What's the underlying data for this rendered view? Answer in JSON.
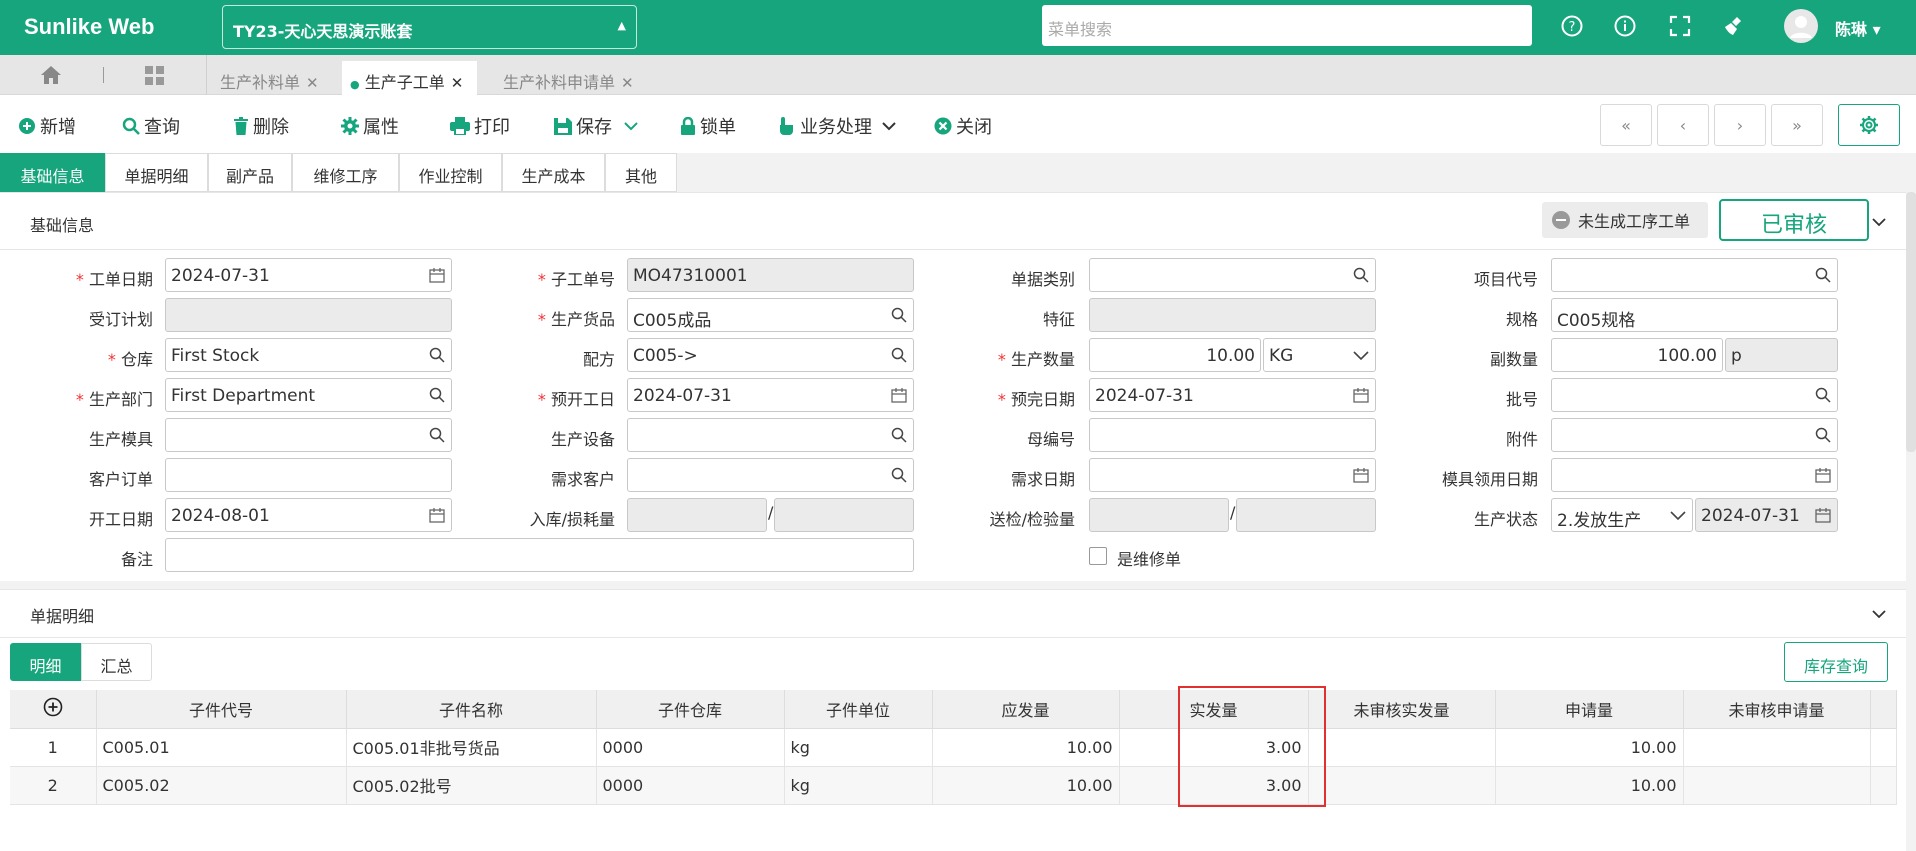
{
  "app": {
    "logo": "Sunlike Web",
    "account": "TY23-天心天思演示账套",
    "search_placeholder": "菜单搜索",
    "user": "陈琳"
  },
  "doc_tabs": [
    {
      "label": "生产补料单"
    },
    {
      "label": "生产子工单"
    },
    {
      "label": "生产补料申请单"
    }
  ],
  "toolbar": {
    "new": "新增",
    "query": "查询",
    "delete": "删除",
    "props": "属性",
    "print": "打印",
    "save": "保存",
    "lock": "锁单",
    "biz": "业务处理",
    "close": "关闭"
  },
  "section_tabs": [
    "基础信息",
    "单据明细",
    "副产品",
    "维修工序",
    "作业控制",
    "生产成本",
    "其他"
  ],
  "basic": {
    "title": "基础信息",
    "status_badge": "未生成工序工单",
    "audit": "已审核"
  },
  "form": {
    "l_date": "工单日期",
    "v_date": "2024-07-31",
    "l_order": "子工单号",
    "v_order": "MO47310001",
    "l_doctype": "单据类别",
    "l_project": "项目代号",
    "l_plan": "受订计划",
    "l_goods": "生产货品",
    "v_goods": "C005成品",
    "l_feature": "特征",
    "l_spec": "规格",
    "v_spec": "C005规格",
    "l_wh": "仓库",
    "v_wh": "First Stock",
    "l_formula": "配方",
    "v_formula": "C005->",
    "l_qty": "生产数量",
    "v_qty": "10.00",
    "v_unit": "KG",
    "l_subqty": "副数量",
    "v_subqty": "100.00",
    "v_subunit": "p",
    "l_dept": "生产部门",
    "v_dept": "First Department",
    "l_start": "预开工日",
    "v_start": "2024-07-31",
    "l_end": "预完日期",
    "v_end": "2024-07-31",
    "l_batch": "批号",
    "l_mold": "生产模具",
    "l_equip": "生产设备",
    "l_parent": "母编号",
    "l_attach": "附件",
    "l_custorder": "客户订单",
    "l_demandcust": "需求客户",
    "l_demanddate": "需求日期",
    "l_moldday": "模具领用日期",
    "l_actstart": "开工日期",
    "v_actstart": "2024-08-01",
    "l_inloss": "入库/损耗量",
    "l_check": "送检/检验量",
    "l_status": "生产状态",
    "v_status": "2.发放生产",
    "v_statusdate": "2024-07-31",
    "l_remark": "备注",
    "l_repair": "是维修单"
  },
  "detail": {
    "title": "单据明细",
    "tab_detail": "明细",
    "tab_sum": "汇总",
    "stock_btn": "库存查询",
    "columns": [
      "子件代号",
      "子件名称",
      "子件仓库",
      "子件单位",
      "应发量",
      "实发量",
      "未审核实发量",
      "申请量",
      "未审核申请量"
    ],
    "rows": [
      {
        "no": "1",
        "code": "C005.01",
        "name": "C005.01非批号货品",
        "wh": "0000",
        "unit": "kg",
        "should": "10.00",
        "actual": "3.00",
        "unaudited": "",
        "apply": "10.00",
        "unapply": ""
      },
      {
        "no": "2",
        "code": "C005.02",
        "name": "C005.02批号",
        "wh": "0000",
        "unit": "kg",
        "should": "10.00",
        "actual": "3.00",
        "unaudited": "",
        "apply": "10.00",
        "unapply": ""
      }
    ]
  },
  "colors": {
    "primary": "#16a57d",
    "highlight": "#e03030"
  }
}
